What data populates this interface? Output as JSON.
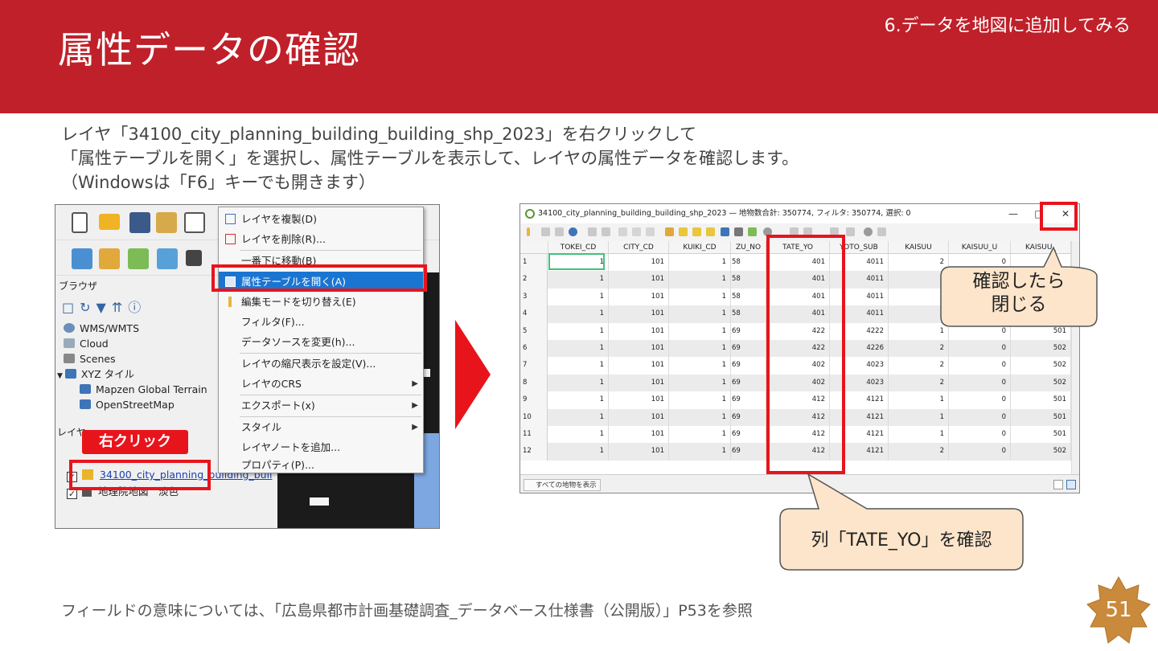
{
  "header": {
    "title": "属性データの確認",
    "section": "6.データを地図に追加してみる"
  },
  "intro": {
    "line1": "レイヤ「34100_city_planning_building_building_shp_2023」を右クリックして",
    "line2": "「属性テーブルを開く」を選択し、属性テーブルを表示して、レイヤの属性データを確認します。",
    "line3": "（Windowsは「F6」キーでも開きます）"
  },
  "left_shot": {
    "browser_label": "ブラウザ",
    "layers_label": "レイヤ",
    "tree": [
      "WMS/WMTS",
      "Cloud",
      "Scenes",
      "XYZ タイル",
      "Mapzen Global Terrain",
      "OpenStreetMap"
    ],
    "layer1": "34100_city_planning_building_buil",
    "layer2": "地理院地図　淡色",
    "right_click_tag": "右クリック",
    "menu": [
      {
        "label": "レイヤを複製(D)",
        "arrow": ""
      },
      {
        "label": "レイヤを削除(R)...",
        "arrow": ""
      },
      {
        "label": "一番下に移動(B)",
        "arrow": ""
      },
      {
        "label": "属性テーブルを開く(A)",
        "arrow": ""
      },
      {
        "label": "編集モードを切り替え(E)",
        "arrow": ""
      },
      {
        "label": "フィルタ(F)...",
        "arrow": ""
      },
      {
        "label": "データソースを変更(h)...",
        "arrow": ""
      },
      {
        "label": "レイヤの縮尺表示を設定(V)...",
        "arrow": ""
      },
      {
        "label": "レイヤのCRS",
        "arrow": "▶"
      },
      {
        "label": "エクスポート(x)",
        "arrow": "▶"
      },
      {
        "label": "スタイル",
        "arrow": "▶"
      },
      {
        "label": "レイヤノートを追加...",
        "arrow": ""
      },
      {
        "label": "プロパティ(P)...",
        "arrow": ""
      }
    ]
  },
  "right_shot": {
    "window_title": "34100_city_planning_building_building_shp_2023 — 地物数合計: 350774, フィルタ: 350774, 選択: 0",
    "minimize": "—",
    "maximize": "□",
    "close": "✕",
    "columns": [
      "TOKEI_CD",
      "CITY_CD",
      "KUIKI_CD",
      "ZU_NO",
      "TATE_YO",
      "YOTO_SUB",
      "KAISUU",
      "KAISUU_U",
      "KAISUU_"
    ],
    "rows": [
      [
        "1",
        "1",
        "101",
        "1",
        "58",
        "401",
        "4011",
        "2",
        "0",
        ""
      ],
      [
        "2",
        "1",
        "101",
        "1",
        "58",
        "401",
        "4011",
        "",
        "",
        ""
      ],
      [
        "3",
        "1",
        "101",
        "1",
        "58",
        "401",
        "4011",
        "",
        "",
        ""
      ],
      [
        "4",
        "1",
        "101",
        "1",
        "58",
        "401",
        "4011",
        "",
        "",
        ""
      ],
      [
        "5",
        "1",
        "101",
        "1",
        "69",
        "422",
        "4222",
        "1",
        "0",
        "501"
      ],
      [
        "6",
        "1",
        "101",
        "1",
        "69",
        "422",
        "4226",
        "2",
        "0",
        "502"
      ],
      [
        "7",
        "1",
        "101",
        "1",
        "69",
        "402",
        "4023",
        "2",
        "0",
        "502"
      ],
      [
        "8",
        "1",
        "101",
        "1",
        "69",
        "402",
        "4023",
        "2",
        "0",
        "502"
      ],
      [
        "9",
        "1",
        "101",
        "1",
        "69",
        "412",
        "4121",
        "1",
        "0",
        "501"
      ],
      [
        "10",
        "1",
        "101",
        "1",
        "69",
        "412",
        "4121",
        "1",
        "0",
        "501"
      ],
      [
        "11",
        "1",
        "101",
        "1",
        "69",
        "412",
        "4121",
        "1",
        "0",
        "501"
      ],
      [
        "12",
        "1",
        "101",
        "1",
        "69",
        "412",
        "4121",
        "2",
        "0",
        "502"
      ]
    ],
    "status_button": "すべての地物を表示"
  },
  "callouts": {
    "close_line1": "確認したら",
    "close_line2": "閉じる",
    "column": "列「TATE_YO」を確認"
  },
  "footer": {
    "note": "フィールドの意味については、「広島県都市計画基礎調査_データベース仕様書（公開版）」P53を参照",
    "page_number": "51"
  },
  "colors": {
    "header": "#c0202a",
    "highlight_red": "#e8141c",
    "callout_fill": "#fde5cb",
    "badge": "#c98a3c"
  }
}
